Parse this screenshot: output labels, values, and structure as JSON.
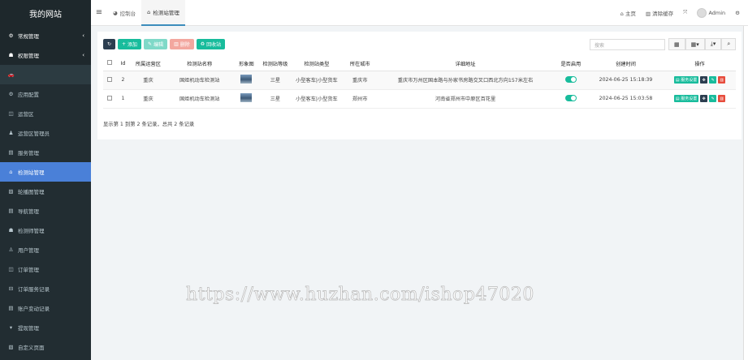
{
  "sidebar": {
    "brand": "我的网站",
    "items": [
      {
        "icon": "gears-icon",
        "glyph": "⚙",
        "label": "常规管理",
        "arrow": "‹"
      },
      {
        "icon": "users-icon",
        "glyph": "☗",
        "label": "权限管理",
        "arrow": "‹"
      },
      {
        "icon": "car-icon",
        "glyph": "🚗",
        "label": "",
        "arrow": ""
      },
      {
        "icon": "gear-icon",
        "glyph": "⚙",
        "label": "应用配置"
      },
      {
        "icon": "square-icon",
        "glyph": "◫",
        "label": "运营区"
      },
      {
        "icon": "user-icon",
        "glyph": "♟",
        "label": "运营区管理员"
      },
      {
        "icon": "list-icon",
        "glyph": "▤",
        "label": "服务管理"
      },
      {
        "icon": "bank-icon",
        "glyph": "⌂",
        "label": "检测站管理"
      },
      {
        "icon": "image-icon",
        "glyph": "▨",
        "label": "轮播图管理"
      },
      {
        "icon": "nav-icon",
        "glyph": "▤",
        "label": "导航管理"
      },
      {
        "icon": "group-icon",
        "glyph": "☗",
        "label": "检测师管理"
      },
      {
        "icon": "user-outline-icon",
        "glyph": "♙",
        "label": "用户管理"
      },
      {
        "icon": "order-icon",
        "glyph": "◫",
        "label": "订单管理"
      },
      {
        "icon": "record-icon",
        "glyph": "⊟",
        "label": "订单服务记录"
      },
      {
        "icon": "account-icon",
        "glyph": "▤",
        "label": "账户变动记录"
      },
      {
        "icon": "filter-icon",
        "glyph": "▾",
        "label": "提现管理"
      },
      {
        "icon": "page-icon",
        "glyph": "▧",
        "label": "自定义页面"
      }
    ]
  },
  "topbar": {
    "tabs": [
      {
        "label": "控制台",
        "icon": "dashboard-icon",
        "glyph": "◕"
      },
      {
        "label": "检测站管理",
        "icon": "bank-icon",
        "glyph": "⌂"
      }
    ],
    "home": "主页",
    "clear_cache": "清除缓存",
    "user": "Admin"
  },
  "toolbar": {
    "add": "添加",
    "edit": "编辑",
    "delete": "删除",
    "recycle": "回收站",
    "search_placeholder": "搜索"
  },
  "table": {
    "headers": [
      "",
      "Id",
      "所属运营区",
      "检测站名称",
      "形象图",
      "检测站等级",
      "检测站类型",
      "所在城市",
      "详细地址",
      "是否启用",
      "创建时间",
      "操作"
    ],
    "rows": [
      {
        "id": "2",
        "region": "重庆",
        "name": "国炬机动车检测站",
        "level": "三星",
        "type": "小型客车|小型货车",
        "city": "重庆市",
        "address": "重庆市万州区国本路与孙家书房路交叉口西北方向157米左右",
        "created": "2024-06-25 15:18:39"
      },
      {
        "id": "1",
        "region": "重庆",
        "name": "国炬机动车检测站",
        "level": "三星",
        "type": "小型客车|小型货车",
        "city": "郑州市",
        "address": "河南省郑州市中原区百花里",
        "created": "2024-06-25 15:03:58"
      }
    ],
    "op_label": "服务设置",
    "summary": "显示第 1 到第 2 条记录，总共 2 条记录"
  },
  "watermark": "https://www.huzhan.com/ishop47020",
  "colors": {
    "sidebar": "#222d32",
    "active": "#4a80d8",
    "success": "#18bc9c",
    "danger": "#e74c3c",
    "dark": "#2c3e50"
  }
}
